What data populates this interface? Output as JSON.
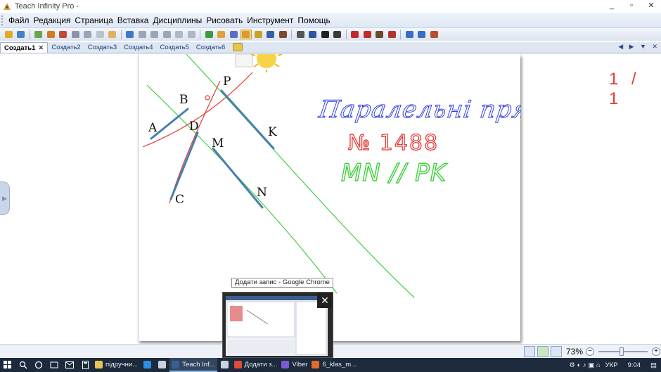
{
  "window": {
    "title": "Teach Infinity Pro -",
    "controls": {
      "minimize": "_",
      "restore": "▫",
      "close": "✕"
    }
  },
  "menu": {
    "items": [
      "Файл",
      "Редакция",
      "Страница",
      "Вставка",
      "Дисциплины",
      "Рисовать",
      "Инструмент",
      "Помощь"
    ]
  },
  "toolbar": {
    "buttons": [
      {
        "name": "open-icon",
        "color": "#e3a928"
      },
      {
        "name": "save-icon",
        "color": "#4a7fc7"
      },
      {
        "name": "sep"
      },
      {
        "name": "new-page-icon",
        "color": "#6da34d"
      },
      {
        "name": "insert-page-icon",
        "color": "#d07a2a"
      },
      {
        "name": "delete-page-icon",
        "color": "#c04a3a"
      },
      {
        "name": "print-icon",
        "color": "#8a95a5"
      },
      {
        "name": "print-preview-icon",
        "color": "#9aa5b5"
      },
      {
        "name": "export-icon",
        "color": "#b9c2cf"
      },
      {
        "name": "hand-icon",
        "color": "#e2b160"
      },
      {
        "name": "sep"
      },
      {
        "name": "undo-icon",
        "color": "#3c7ac9"
      },
      {
        "name": "redo-icon",
        "color": "#9aa5b5"
      },
      {
        "name": "cut-icon",
        "color": "#9aa5b5"
      },
      {
        "name": "copy-icon",
        "color": "#9aa5b5"
      },
      {
        "name": "paste-icon",
        "color": "#b0b8c4"
      },
      {
        "name": "clone-icon",
        "color": "#b0b8c4"
      },
      {
        "name": "sep"
      },
      {
        "name": "select-icon",
        "color": "#3f9a3f"
      },
      {
        "name": "magic-icon",
        "color": "#e0a23a"
      },
      {
        "name": "pen-icon",
        "color": "#5a6fc4"
      },
      {
        "name": "brush-icon",
        "color": "#d89b2d",
        "active": true
      },
      {
        "name": "highlighter-icon",
        "color": "#c9a22a"
      },
      {
        "name": "eraser-icon",
        "color": "#3b5ea8"
      },
      {
        "name": "stamp-icon",
        "color": "#7c4b2c"
      },
      {
        "name": "sep"
      },
      {
        "name": "shape-icon",
        "color": "#555555"
      },
      {
        "name": "line-icon",
        "color": "#2b56a3"
      },
      {
        "name": "text-icon",
        "color": "#222222"
      },
      {
        "name": "fill-icon",
        "color": "#3a3a3a"
      },
      {
        "name": "sep"
      },
      {
        "name": "formula-icon",
        "color": "#c22b2b"
      },
      {
        "name": "abc-icon",
        "color": "#c22b2b"
      },
      {
        "name": "ruler-icon",
        "color": "#6b4a2c"
      },
      {
        "name": "flask-icon",
        "color": "#b3342f"
      },
      {
        "name": "sep"
      },
      {
        "name": "screen-icon",
        "color": "#3a6ec4"
      },
      {
        "name": "record-icon",
        "color": "#3a6ec4"
      },
      {
        "name": "settings-icon",
        "color": "#b84c2c"
      }
    ]
  },
  "tabs": {
    "items": [
      "Создать1",
      "Создать2",
      "Создать3",
      "Создать4",
      "Создать5",
      "Создать6"
    ],
    "close_glyph": "✕",
    "nav": "◀ ▶ ▼ ✕"
  },
  "board": {
    "page_counter": "1 / 1",
    "points": {
      "A": "A",
      "B": "B",
      "D": "D",
      "C": "C",
      "P": "P",
      "K": "K",
      "M": "M",
      "N": "N"
    },
    "heading": "Паралельні прямі",
    "number": "№ 1488",
    "statement": "MN // PK"
  },
  "status": {
    "zoom": "73%",
    "zoom_minus": "−",
    "zoom_plus": "+"
  },
  "preview": {
    "tooltip": "Додати запис - Google Chrome",
    "close": "✕"
  },
  "taskbar": {
    "apps": [
      {
        "label": "підручни...",
        "color": "#e9c25a",
        "active": false
      },
      {
        "label": "",
        "color": "#2f8de0",
        "active": false,
        "name": "edge-icon"
      },
      {
        "label": "",
        "color": "#c9d3df",
        "active": false,
        "name": "store-icon"
      },
      {
        "label": "Teach Inf...",
        "color": "#3a5d92",
        "active": true
      },
      {
        "label": "",
        "color": "#c9d3df",
        "active": false,
        "name": "game-icon"
      },
      {
        "label": "Додати з...",
        "color": "#e24a3b",
        "active": false
      },
      {
        "label": "Viber",
        "color": "#7a5bd6",
        "active": false
      },
      {
        "label": "6_klas_m...",
        "color": "#e36b2b",
        "active": false
      }
    ],
    "tray": {
      "language": "УКР",
      "time": "9:04"
    }
  }
}
